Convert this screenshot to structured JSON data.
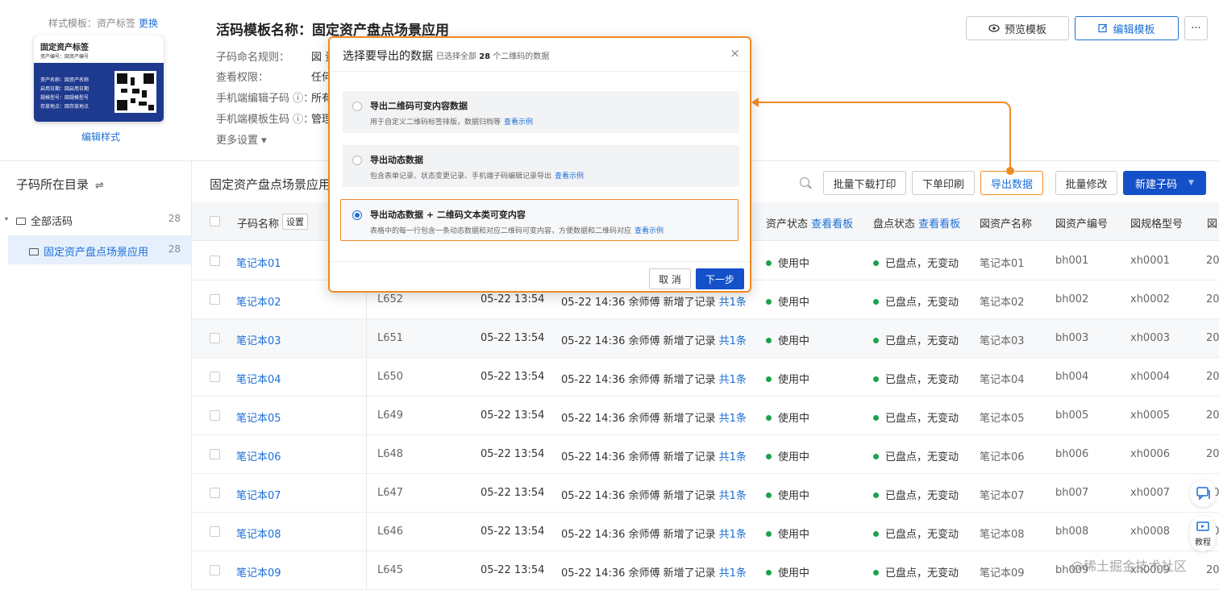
{
  "header": {
    "template_label": "样式模板：资产标签",
    "change_link": "更换",
    "card": {
      "title": "固定资产标签",
      "subtitle": "资产编号：図资产编号",
      "lines": [
        "资产名称：図资产名称",
        "启用日期：図启用日期",
        "规格型号：図规格型号",
        "存放地点：図存放地点"
      ]
    },
    "edit_style": "编辑样式",
    "title": "活码模板名称：固定资产盘点场景应用",
    "info": [
      {
        "label": "子码命名规则：",
        "value": "図 资"
      },
      {
        "label": "查看权限：",
        "value": "任何"
      },
      {
        "label": "手机端编辑子码 ⓘ：",
        "value": "所有"
      },
      {
        "label": "手机端模板生码 ⓘ：",
        "value": "管理"
      }
    ],
    "more": "更多设置 ▾",
    "preview_btn": "预览模板",
    "edit_btn": "编辑模板",
    "more_btn": "···"
  },
  "sidebar": {
    "title": "子码所在目录",
    "switch_icon": "⇌",
    "items": [
      {
        "label": "全部活码",
        "count": "28"
      },
      {
        "label": "固定资产盘点场景应用",
        "count": "28"
      }
    ]
  },
  "toolbar": {
    "path": "固定资产盘点场景应用",
    "batch_print": "批量下载打印",
    "order_print": "下单印刷",
    "export": "导出数据",
    "batch_edit": "批量修改",
    "new_code": "新建子码"
  },
  "table": {
    "headers": {
      "name": "子码名称",
      "setting": "设置",
      "asset_status": "资产状态",
      "asset_board": "查看看板",
      "check_status": "盘点状态",
      "check_board": "查看看板",
      "asset_name": "図资产名称",
      "asset_no": "図资产编号",
      "spec": "図规格型号",
      "extra": "図"
    },
    "rows": [
      {
        "name": "笔记本01",
        "code": "",
        "created": "",
        "log": "",
        "log_link": "",
        "status": "使用中",
        "check": "已盘点，无变动",
        "asset_name": "笔记本01",
        "asset_no": "bh001",
        "spec": "xh0001",
        "extra": "20"
      },
      {
        "name": "笔记本02",
        "code": "L652",
        "created": "05-22 13:54",
        "log": "05-22 14:36 余师傅 新增了记录",
        "log_link": "共1条",
        "status": "使用中",
        "check": "已盘点，无变动",
        "asset_name": "笔记本02",
        "asset_no": "bh002",
        "spec": "xh0002",
        "extra": "20"
      },
      {
        "name": "笔记本03",
        "code": "L651",
        "created": "05-22 13:54",
        "log": "05-22 14:36 余师傅 新增了记录",
        "log_link": "共1条",
        "status": "使用中",
        "check": "已盘点，无变动",
        "asset_name": "笔记本03",
        "asset_no": "bh003",
        "spec": "xh0003",
        "extra": "20"
      },
      {
        "name": "笔记本04",
        "code": "L650",
        "created": "05-22 13:54",
        "log": "05-22 14:36 余师傅 新增了记录",
        "log_link": "共1条",
        "status": "使用中",
        "check": "已盘点，无变动",
        "asset_name": "笔记本04",
        "asset_no": "bh004",
        "spec": "xh0004",
        "extra": "20"
      },
      {
        "name": "笔记本05",
        "code": "L649",
        "created": "05-22 13:54",
        "log": "05-22 14:36 余师傅 新增了记录",
        "log_link": "共1条",
        "status": "使用中",
        "check": "已盘点，无变动",
        "asset_name": "笔记本05",
        "asset_no": "bh005",
        "spec": "xh0005",
        "extra": "20"
      },
      {
        "name": "笔记本06",
        "code": "L648",
        "created": "05-22 13:54",
        "log": "05-22 14:36 余师傅 新增了记录",
        "log_link": "共1条",
        "status": "使用中",
        "check": "已盘点，无变动",
        "asset_name": "笔记本06",
        "asset_no": "bh006",
        "spec": "xh0006",
        "extra": "20"
      },
      {
        "name": "笔记本07",
        "code": "L647",
        "created": "05-22 13:54",
        "log": "05-22 14:36 余师傅 新增了记录",
        "log_link": "共1条",
        "status": "使用中",
        "check": "已盘点，无变动",
        "asset_name": "笔记本07",
        "asset_no": "bh007",
        "spec": "xh0007",
        "extra": "20"
      },
      {
        "name": "笔记本08",
        "code": "L646",
        "created": "05-22 13:54",
        "log": "05-22 14:36 余师傅 新增了记录",
        "log_link": "共1条",
        "status": "使用中",
        "check": "已盘点，无变动",
        "asset_name": "笔记本08",
        "asset_no": "bh008",
        "spec": "xh0008",
        "extra": "20"
      },
      {
        "name": "笔记本09",
        "code": "L645",
        "created": "05-22 13:54",
        "log": "05-22 14:36 余师傅 新增了记录",
        "log_link": "共1条",
        "status": "使用中",
        "check": "已盘点，无变动",
        "asset_name": "笔记本09",
        "asset_no": "bh009",
        "spec": "xh0009",
        "extra": "20"
      }
    ]
  },
  "modal": {
    "title": "选择要导出的数据",
    "sub_pre": "已选择全部",
    "sub_count": "28",
    "sub_post": "个二维码的数据",
    "close": "×",
    "options": [
      {
        "title": "导出二维码可变内容数据",
        "desc": "用于自定义二维码标签排版，数据归档等",
        "link": "查看示例",
        "selected": false
      },
      {
        "title": "导出动态数据",
        "desc": "包含表单记录、状态变更记录、手机端子码编辑记录导出",
        "link": "查看示例",
        "selected": false
      },
      {
        "title": "导出动态数据 + 二维码文本类可变内容",
        "desc": "表格中的每一行包含一条动态数据和对应二维码可变内容，方便数据和二维码对应",
        "link": "查看示例",
        "selected": true
      }
    ],
    "cancel": "取 消",
    "next": "下一步"
  },
  "floats": {
    "tutorial": "教程"
  },
  "watermark": "@稀土掘金技术社区",
  "colors": {
    "accent": "#1c6fd6",
    "primary_btn": "#1450c8",
    "highlight": "#f08a24",
    "status_green": "#1aa34a"
  }
}
